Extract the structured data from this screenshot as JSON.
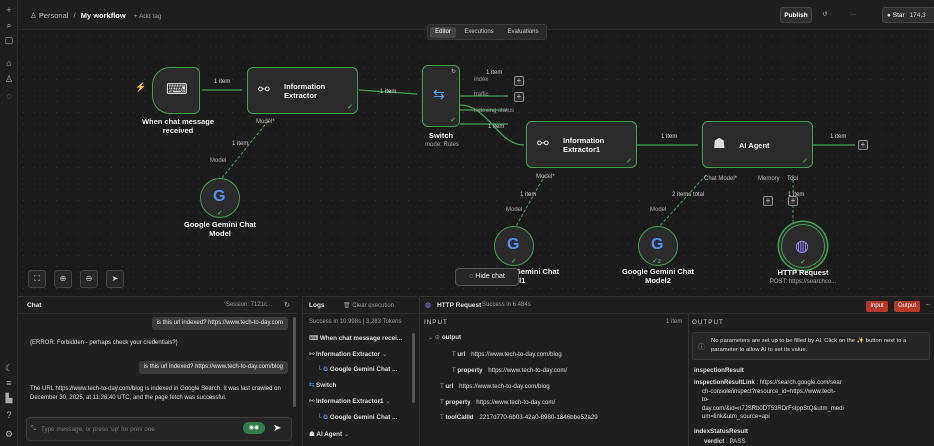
{
  "topbar": {
    "workspace": "Personal",
    "workflow_name": "My workflow",
    "add_tag": "+ Add tag",
    "publish": "Publish",
    "more": "···",
    "star": "Star",
    "star_count": "174,3"
  },
  "tabs": [
    {
      "label": "Editor"
    },
    {
      "label": "Executions"
    },
    {
      "label": "Evaluations"
    }
  ],
  "nodes": {
    "trigger": {
      "label1": "When chat message",
      "label2": "received"
    },
    "extractor": {
      "label1": "Information",
      "label2": "Extractor",
      "port": "Model*"
    },
    "switch": {
      "label": "Switch",
      "sub": "mode: Rules",
      "out1": "index",
      "out2": "traffic",
      "out3": "indexing status"
    },
    "extractor1": {
      "label1": "Information",
      "label2": "Extractor1",
      "port": "Model*"
    },
    "agent": {
      "label": "AI Agent",
      "port1": "Chat Model*",
      "port2": "Memory",
      "port3": "Tool"
    },
    "gemini": {
      "label1": "Google Gemini Chat",
      "label2": "Model"
    },
    "gemini1": {
      "label1": "Gemini Chat",
      "label2": "el1"
    },
    "gemini2": {
      "label1": "Google Gemini Chat",
      "label2": "Model2",
      "badge": "2"
    },
    "http": {
      "label": "HTTP Request",
      "sub": "POST: https://searchco..."
    }
  },
  "edges": {
    "e1": "1 item",
    "e2": "1 item",
    "e3": "1 item",
    "e4": "1 item",
    "e5": "1 item",
    "e6": "1 item",
    "e7": "1 item",
    "e8": "1 item",
    "e9": "2 items total",
    "e10": "1 item",
    "model": "Model",
    "model_b": "Model",
    "model_c": "Model"
  },
  "hide_chat": "Hide chat",
  "chat": {
    "title": "Chat",
    "session": "Session: 7121c...",
    "messages": [
      {
        "role": "user",
        "text": "is this url indexed? https://www.tech-to-day.com"
      },
      {
        "role": "bot",
        "text": "{ERROR: Forbidden - perhaps check your credentials?}"
      },
      {
        "role": "user",
        "text": "is this url indexed? https://www.tech-to-day.com/blog"
      },
      {
        "role": "bot",
        "text": "The URL https://www.tech-to-day.com/blog is indexed in Google Search. It was last crawled on December 30, 2025, at 11:26:40 UTC, and the page fetch was successful."
      }
    ],
    "placeholder": "Type message, or press 'up' for prev one"
  },
  "logs": {
    "title": "Logs",
    "clear": "Clear execution",
    "status": "Success in 10.998s",
    "tokens": "3,283 Tokens",
    "items": [
      {
        "label": "When chat message recei..."
      },
      {
        "label": "Information Extractor"
      },
      {
        "label": "Google Gemini Chat ..."
      },
      {
        "label": "Switch"
      },
      {
        "label": "Information Extractor1"
      },
      {
        "label": "Google Gemini Chat ..."
      },
      {
        "label": "AI Agent"
      }
    ]
  },
  "http_panel": {
    "title": "HTTP Request",
    "status": "Success in 6.484s",
    "input_btn": "Input",
    "output_btn": "Output",
    "input_title": "INPUT",
    "item_count": "1 item",
    "input_rows": [
      {
        "key": "output",
        "value": ""
      },
      {
        "key": "url",
        "value": "https://www.tech-to-day.com/blog"
      },
      {
        "key": "property",
        "value": "https://www.tech-to-day.com/"
      },
      {
        "key": "url",
        "value": "https://www.tech-to-day.com/blog"
      },
      {
        "key": "property",
        "value": "https://www.tech-to-day.com/"
      },
      {
        "key": "toolCallId",
        "value": "2217d770-6b03-42a0-8980-1846bbe52a29"
      }
    ],
    "output_title": "OUTPUT",
    "notice": "No parameters are set up to be filled by AI. Click on the ✨ button next to a parameter to allow AI to set its value.",
    "inspection_result": "inspectionResult",
    "link_key": "inspectionResultLink",
    "link_lines": [
      ": https://search.google.com/sear",
      "ch-console/inspect?resource_id=https://www.tech-",
      "to-",
      "day.com/&id=n7JSRb0DT53RDrFsIppStQ&utm_medi",
      "um=link&utm_source=api"
    ],
    "status_key": "indexStatusResult",
    "verdict_key": "verdict",
    "verdict_val": ": PASS"
  }
}
